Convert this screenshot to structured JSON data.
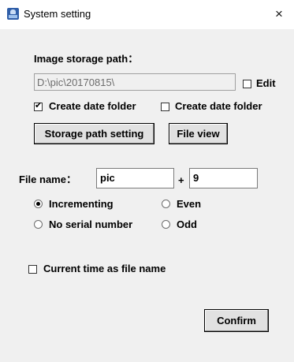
{
  "window": {
    "title": "System setting",
    "close_glyph": "×"
  },
  "storage": {
    "label": "Image storage path：",
    "path_value": "D:\\pic\\20170815\\",
    "edit_label": "Edit",
    "edit_checked": false,
    "create_date_folder_1_label": "Create date folder",
    "create_date_folder_1_checked": true,
    "create_date_folder_2_label": "Create date folder",
    "create_date_folder_2_checked": false,
    "storage_path_button": "Storage path setting",
    "file_view_button": "File view"
  },
  "filename": {
    "label": "File name：",
    "prefix_value": "pic",
    "plus": "+",
    "serial_value": "9",
    "modes": {
      "incrementing": "Incrementing",
      "even": "Even",
      "no_serial": "No serial number",
      "odd": "Odd",
      "selected": "incrementing"
    }
  },
  "current_time": {
    "label": "Current time as file name",
    "checked": false
  },
  "confirm_button": "Confirm",
  "icons": {
    "app": "app-icon",
    "close": "close-icon",
    "checkmark": "✔"
  }
}
